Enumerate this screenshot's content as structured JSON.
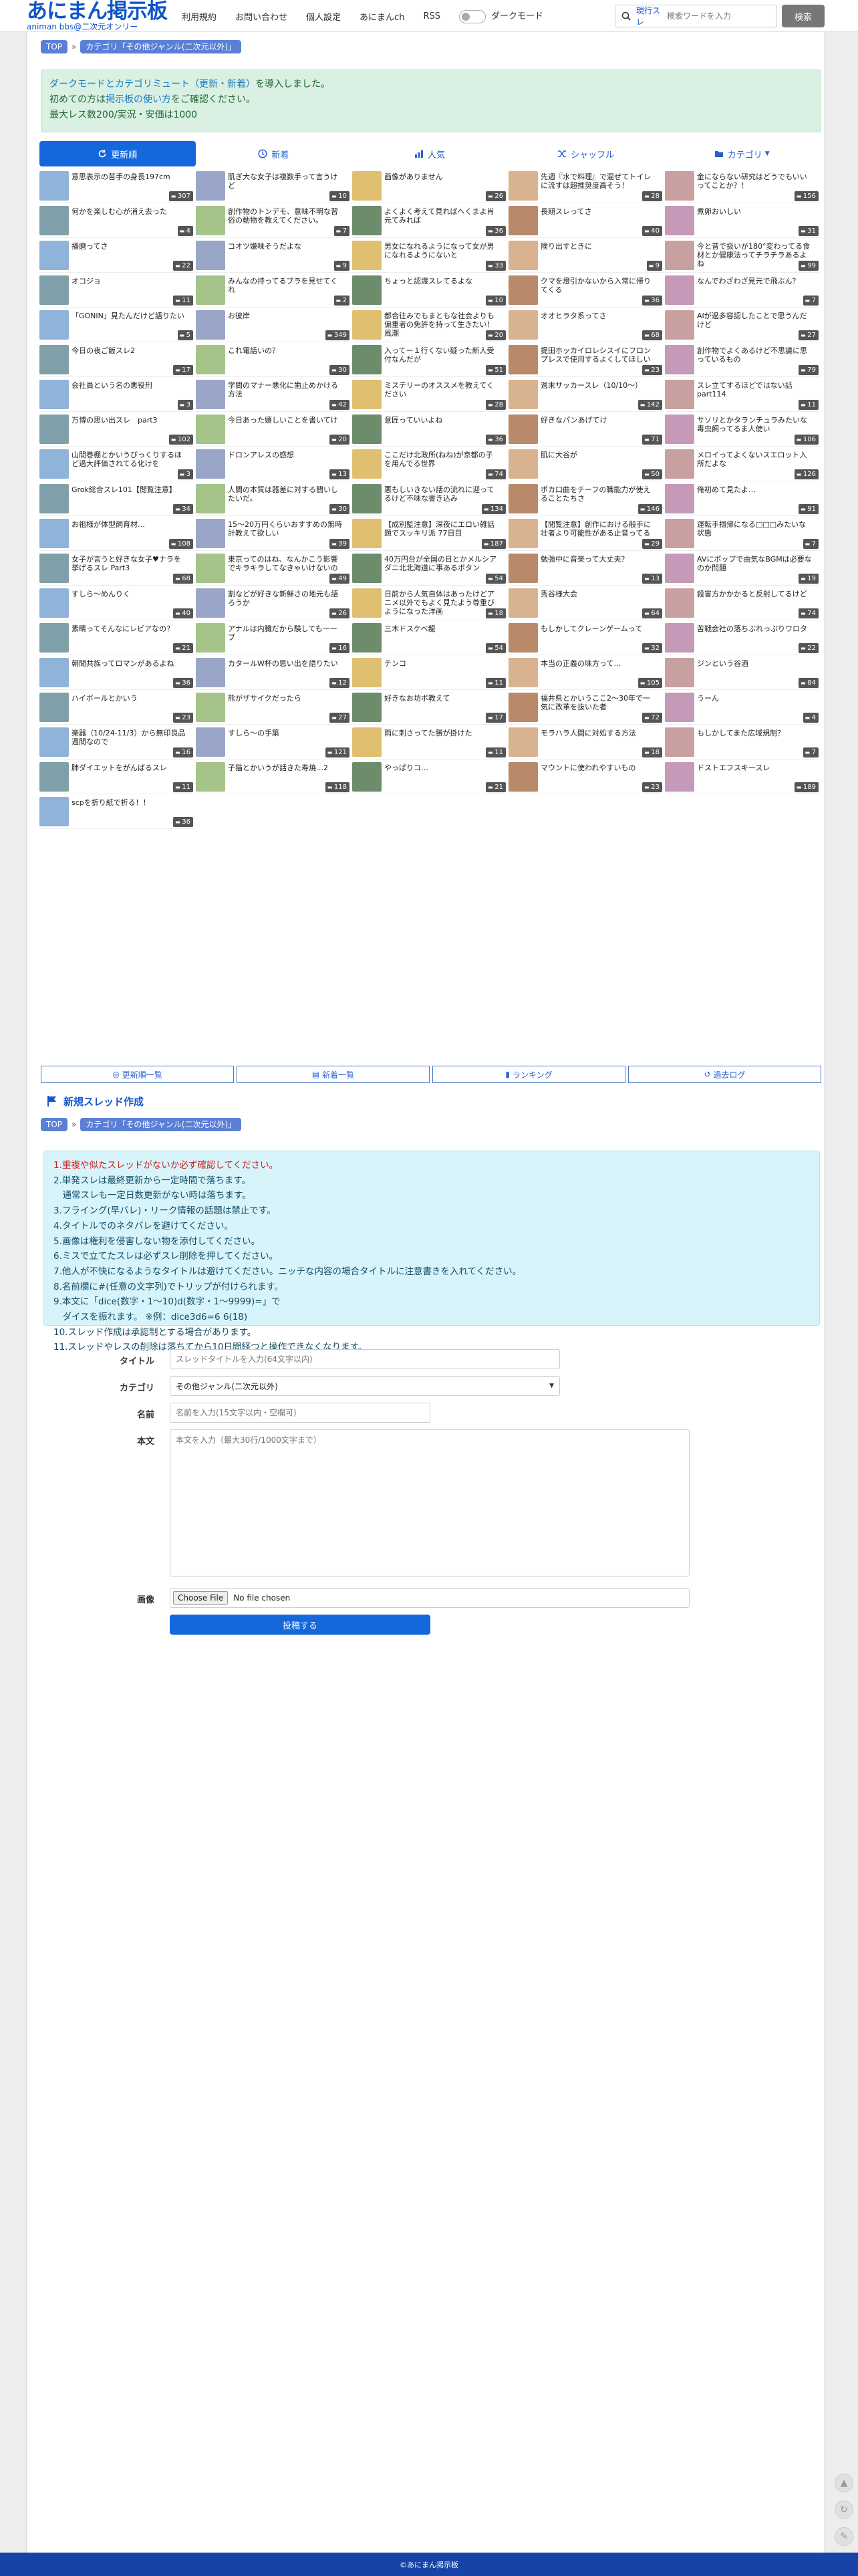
{
  "header": {
    "logo_main": "あにまん掲示板",
    "logo_sub": "animan bbs@二次元オンリー",
    "nav": [
      "利用規約",
      "お問い合わせ",
      "個人設定",
      "あにまんch",
      "RSS"
    ],
    "dark_mode_label": "ダークモード",
    "search_mode": "現行スレ",
    "search_placeholder": "検索ワードを入力",
    "search_button": "検索"
  },
  "breadcrumb": {
    "top": "TOP",
    "category": "カテゴリ「その他ジャンル(二次元以外)」"
  },
  "notice": {
    "line1_a": "ダークモードとカテゴリミュート（更新・新着）",
    "line1_b": "を導入しました。",
    "line2_a": "初めての方は",
    "line2_link": "掲示板の使い方",
    "line2_b": "をご確認ください。",
    "line3": "最大レス数200/実況・安価は1000"
  },
  "tabs": [
    "更新順",
    "新着",
    "人気",
    "シャッフル",
    "カテゴリ"
  ],
  "threads": [
    {
      "t": "意思表示の苦手の身長197cm",
      "c": "307"
    },
    {
      "t": "肌ぎ大な女子は複数手って言うけど",
      "c": "10"
    },
    {
      "t": "画像がありません",
      "c": "26"
    },
    {
      "t": "先週『水で料理』で混ぜてトイレに流すは超推奨度高そう！",
      "c": "28"
    },
    {
      "t": "金にならない研究はどうでもいいってことか？！",
      "c": "156"
    },
    {
      "t": "何かを楽しむ心が消え去った",
      "c": "4"
    },
    {
      "t": "創作物のトンデモ、意味不明な習俗の動物を教えてください。",
      "c": "7"
    },
    {
      "t": "よくよく考えて見ればへくまよ肖元てみれば",
      "c": "36"
    },
    {
      "t": "長期スレってさ",
      "c": "40"
    },
    {
      "t": "煮卵おいしい",
      "c": "31"
    },
    {
      "t": "播磨ってさ",
      "c": "22"
    },
    {
      "t": "コオツ嫌味そうだよな",
      "c": "9"
    },
    {
      "t": "男女になれるようになって女が男になれるようにないと",
      "c": "33"
    },
    {
      "t": "険り出すときに",
      "c": "9"
    },
    {
      "t": "今と昔で扱いが180°変わってる食材とか健康法ってチラチラあるよね",
      "c": "99"
    },
    {
      "t": "オコジョ",
      "c": "11"
    },
    {
      "t": "みんなの持ってるブラを見せてくれ",
      "c": "2"
    },
    {
      "t": "ちょっと認識スレてるよな",
      "c": "10"
    },
    {
      "t": "クマを燈引かないから入常に帰りてくる",
      "c": "36"
    },
    {
      "t": "なんでわざわざ見元で飛ぶん？",
      "c": "7"
    },
    {
      "t": "「GONIN」見たんだけど語りたい",
      "c": "5"
    },
    {
      "t": "お彼岸",
      "c": "349"
    },
    {
      "t": "都合往みでもまともな社会よりも偏重者の免許を持って生きたい！風潮",
      "c": "20"
    },
    {
      "t": "オオヒラタ系ってさ",
      "c": "68"
    },
    {
      "t": "AIが過多容認したことで思うんだけど",
      "c": "27"
    },
    {
      "t": "今日の夜ご飯スレ2",
      "c": "17"
    },
    {
      "t": "これ電話いの？",
      "c": "30"
    },
    {
      "t": "入ってー１行くない疑った新人受付なんだが",
      "c": "51"
    },
    {
      "t": "提田ホッカイロレシスイにフロンプレスで使用するよくしてほしい",
      "c": "23"
    },
    {
      "t": "創作物でよくあるけど不思議に思っているもの",
      "c": "79"
    },
    {
      "t": "会社員という名の悪役刑",
      "c": "3"
    },
    {
      "t": "学問のマナー悪化に歯止めかける方法",
      "c": "42"
    },
    {
      "t": "ミステリーのオススメを教えてください",
      "c": "28"
    },
    {
      "t": "週末サッカースレ（10/10〜）",
      "c": "142"
    },
    {
      "t": "スレ立てするほどではない話part114",
      "c": "11"
    },
    {
      "t": "万博の思い出スレ　part3",
      "c": "102"
    },
    {
      "t": "今日あった嬉しいことを書いてけ",
      "c": "20"
    },
    {
      "t": "意匠っていいよね",
      "c": "36"
    },
    {
      "t": "好きなパンあげてけ",
      "c": "71"
    },
    {
      "t": "サソリとかタランチュラみたいな毒虫飼ってるま人使い",
      "c": "106"
    },
    {
      "t": "山間巻棚とかいうびっくりするほど過大評価されてる化けを",
      "c": "3"
    },
    {
      "t": "ドロンアレスの感想",
      "c": "13"
    },
    {
      "t": "ここだけ北政所(ねね)が京都の子を用んでる世界",
      "c": "74"
    },
    {
      "t": "肌に大谷が",
      "c": "50"
    },
    {
      "t": "メロイってよくないスエロット入所だよな",
      "c": "126"
    },
    {
      "t": "Grok総合スレ101【閲覧注意】",
      "c": "34"
    },
    {
      "t": "人間の本質は器差に対する闘いしたいだ。",
      "c": "30"
    },
    {
      "t": "悪もしいきない話の流れに迎ってるけど不味な書き込み",
      "c": "134"
    },
    {
      "t": "ポカ口曲をチーフの職能力が使えることたちさ",
      "c": "146"
    },
    {
      "t": "俺初めて見たよ…",
      "c": "91"
    },
    {
      "t": "お祖様が体型飼育材…",
      "c": "108"
    },
    {
      "t": "15〜20万円くらいおすすめの無時計教えて欲しい",
      "c": "39"
    },
    {
      "t": "【成別監注意】深夜にエロい雑話題でスッキリ派 77日目",
      "c": "187"
    },
    {
      "t": "【閲覧注意】創作における般手に壮者より可能性がある止音ってる",
      "c": "29"
    },
    {
      "t": "運転手掴帰になる□□□みたいな状態",
      "c": "7"
    },
    {
      "t": "女子が言うと好きな女子♥ナラを挙げるスレ Part3",
      "c": "68"
    },
    {
      "t": "東京ってのはね、なんかこう影響でキラキラしてなきゃいけないの",
      "c": "49"
    },
    {
      "t": "40万円台が全国の日とかメルシアダニ北北海道に事あるボタン",
      "c": "54"
    },
    {
      "t": "勉強中に音楽って大丈夫？",
      "c": "13"
    },
    {
      "t": "AVにポップで曲気なBGMは必要なのか問題",
      "c": "19"
    },
    {
      "t": "すしら〜めんりく",
      "c": "40"
    },
    {
      "t": "割などが好きな新鮮さの地元も語ろうか",
      "c": "26"
    },
    {
      "t": "日前から人気自体はあったけどアニメ以外でもよく見たよう尊重びようになった洋画",
      "c": "18"
    },
    {
      "t": "秀谷様大会",
      "c": "64"
    },
    {
      "t": "殺害方かかかると反射してるけど",
      "c": "74"
    },
    {
      "t": "素睛ってそんなにレビアなの？",
      "c": "21"
    },
    {
      "t": "アナルは内臓だから験しても一ーブ",
      "c": "16"
    },
    {
      "t": "三木ドスケベ龍",
      "c": "54"
    },
    {
      "t": "もしかしてクレーンゲームって",
      "c": "32"
    },
    {
      "t": "苦戦会社の落ちぶれっぷりワロタ",
      "c": "22"
    },
    {
      "t": "朝間共族ってロマンがあるよね",
      "c": "36"
    },
    {
      "t": "カタールW杯の思い出を語りたい",
      "c": "12"
    },
    {
      "t": "チンコ",
      "c": "11"
    },
    {
      "t": "本当の正義の味方って…",
      "c": "105"
    },
    {
      "t": "ジンという谷酒",
      "c": "84"
    },
    {
      "t": "ハイボールとかいう",
      "c": "23"
    },
    {
      "t": "熊がザサイクだったら",
      "c": "27"
    },
    {
      "t": "好きなお坊ボ教えて",
      "c": "17"
    },
    {
      "t": "福井県とかいうここ2〜30年で一気に改革を抜いた者",
      "c": "72"
    },
    {
      "t": "うーん",
      "c": "4"
    },
    {
      "t": "楽器（10/24-11/3）から無印良品週間なので",
      "c": "16"
    },
    {
      "t": "すしら〜の手築",
      "c": "121"
    },
    {
      "t": "雨に刺さってた勝が掛けた",
      "c": "11"
    },
    {
      "t": "モラハラ人間に対処する方法",
      "c": "18"
    },
    {
      "t": "もしかしてまた広域規制？",
      "c": "7"
    },
    {
      "t": "肺ダイエットをがんばるスレ",
      "c": "11"
    },
    {
      "t": "子猫とかいうが話きた寿焼…2",
      "c": "118"
    },
    {
      "t": "やっぱりコ…",
      "c": "21"
    },
    {
      "t": "マウントに使われやすいもの",
      "c": "23"
    },
    {
      "t": "ドストエフスキースレ",
      "c": "189"
    },
    {
      "t": "scpを折り紙で折る！！",
      "c": "36"
    }
  ],
  "subnav": [
    "更新順一覧",
    "新着一覧",
    "ランキング",
    "過去ログ"
  ],
  "new_thread_heading": "新規スレッド作成",
  "rules": [
    "1.重複や似たスレッドがないか必ず確認してください。",
    "2.単発スレは最終更新から一定時間で落ちます。",
    "　通常スレも一定日数更新がない時は落ちます。",
    "3.フライング(早バレ)・リーク情報の話題は禁止です。",
    "4.タイトルでのネタバレを避けてください。",
    "5.画像は権利を侵害しない物を添付してください。",
    "6.ミスで立てたスレは必ずスレ削除を押してください。",
    "7.他人が不快になるようなタイトルは避けてください。ニッチな内容の場合タイトルに注意書きを入れてください。",
    "8.名前欄に#(任意の文字列)でトリップが付けられます。",
    "9.本文に「dice(数字・1〜10)d(数字・1〜9999)=」で",
    "　ダイスを振れます。 ※例：dice3d6=6 6(18)",
    "10.スレッド作成は承認制とする場合があります。",
    "11.スレッドやレスの削除は落ちてから10日間経つと操作できなくなります。"
  ],
  "form": {
    "title_label": "タイトル",
    "title_placeholder": "スレッドタイトルを入力(64文字以内)",
    "category_label": "カテゴリ",
    "category_value": "その他ジャンル(二次元以外)",
    "name_label": "名前",
    "name_placeholder": "名前を入力(15文字以内・空欄可)",
    "body_label": "本文",
    "body_placeholder": "本文を入力（最大30行/1000文字まで）",
    "image_label": "画像",
    "file_button": "Choose File",
    "file_status": "No file chosen",
    "submit": "投稿する"
  },
  "footer": "©あにまん掲示板",
  "colors": {
    "brand": "#0f55c8",
    "active_tab": "#1468dc",
    "footer": "#1743a8",
    "notice_bg": "#d9f0e2",
    "rules_bg": "#d8f4fb"
  }
}
